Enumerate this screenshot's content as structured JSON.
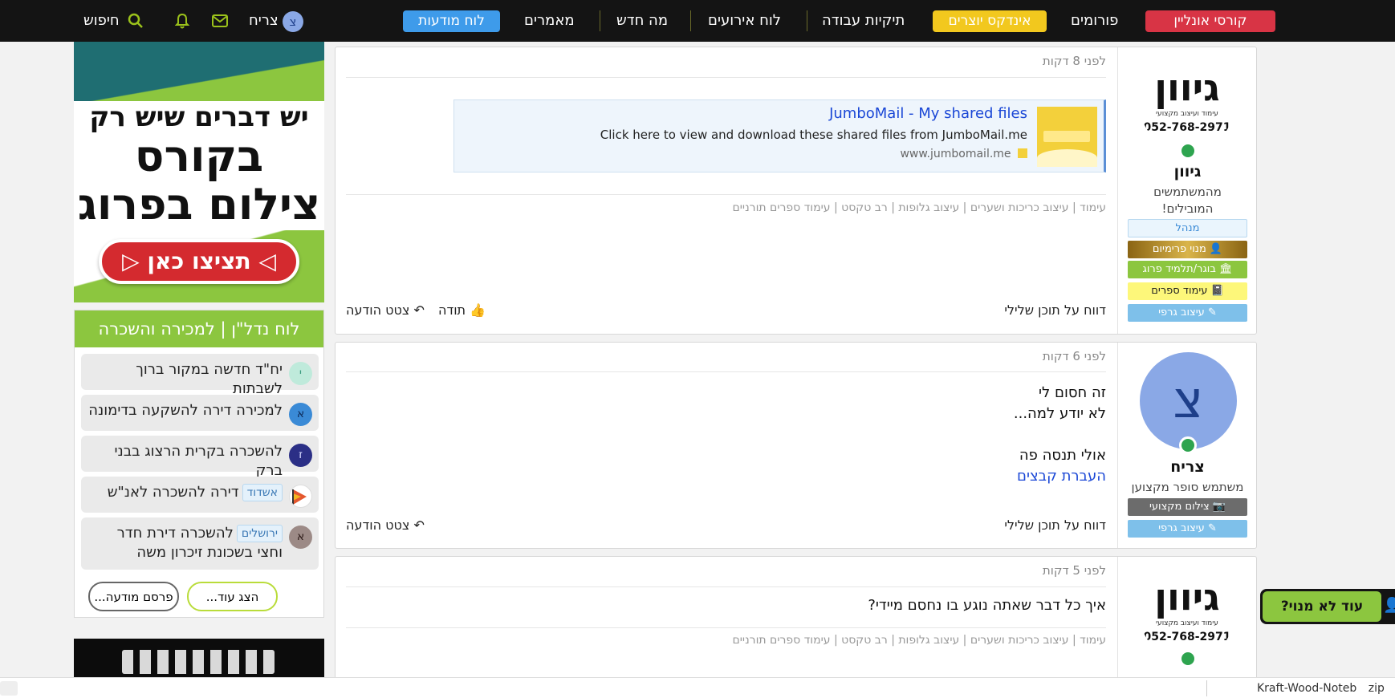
{
  "nav": {
    "online_courses": "קורסי אונליין",
    "forums": "פורומים",
    "creators_index": "אינדקס יוצרים",
    "job_portfolios": "תיקיות עבודה",
    "events_board": "לוח אירועים",
    "whats_new": "מה חדש",
    "articles": "מאמרים",
    "ads_board": "לוח מודעות",
    "user_name": "צריח",
    "user_avatar_letter": "צ",
    "search": "חיפוש"
  },
  "sidebar": {
    "ad_headline_1": "יש דברים שיש רק",
    "ad_headline_2": "בקורס",
    "ad_headline_3": "צילום בפרוג",
    "ad_cta": "תציצו כאן",
    "board_title": "לוח נדל\"ן | למכירה והשכרה",
    "items": [
      {
        "avatar": "י",
        "tag": "",
        "text": "יח\"ד חדשה במקור ברוך לשבתות"
      },
      {
        "avatar": "א",
        "tag": "",
        "text": "למכירה דירה להשקעה בדימונה"
      },
      {
        "avatar": "ז",
        "tag": "",
        "text": "להשכרה בקרית הרצוג בבני ברק"
      },
      {
        "avatar": "",
        "tag": "אשדוד",
        "text": "דירה להשכרה לאנ\"ש"
      },
      {
        "avatar": "א",
        "tag": "ירושלים",
        "text": "להשכרה דירת חדר וחצי בשכונת זיכרון משה"
      }
    ],
    "show_more": "הצג עוד...",
    "post_ad": "פרסם מודעה..."
  },
  "logo": {
    "name_art": "גיוון",
    "tagline": "עימוד ועיצוב מקצועי",
    "phone": "052-768-2971"
  },
  "posts": [
    {
      "timestamp": "לפני 8 דקות",
      "link_preview": {
        "title": "JumboMail - My shared files",
        "description": "Click here to view and download these shared files from JumboMail.me",
        "domain": "www.jumbomail.me"
      },
      "signature": "עימוד | עיצוב כריכות ושערים | עיצוב גלופות | רב טקסט | עימוד ספרים תורניים",
      "report": "דווח על תוכן שלילי",
      "thanks": "תודה",
      "quote": "צטט הודעה",
      "author": {
        "name": "גיוון",
        "title": "מהמשתמשים המובילים!",
        "role": "מנהל",
        "badges": [
          "מנוי פרימיום",
          "בוגר/תלמיד פרוג",
          "עימוד ספרים",
          "עיצוב גרפי"
        ]
      }
    },
    {
      "timestamp": "לפני 6 דקות",
      "lines": [
        "זה חסום לי",
        "לא יודע למה...",
        "אולי תנסה פה"
      ],
      "link": "העברת קבצים",
      "report": "דווח על תוכן שלילי",
      "quote": "צטט הודעה",
      "author": {
        "name": "צריח",
        "avatar_letter": "צ",
        "title": "משתמש סופר מקצוען",
        "badges": [
          "צילום מקצועי",
          "עיצוב גרפי"
        ]
      }
    },
    {
      "timestamp": "לפני 5 דקות",
      "text": "איך כל דבר שאתה נוגע בו נחסם מיידי?",
      "signature": "עימוד | עיצוב כריכות ושערים | עיצוב גלופות | רב טקסט | עימוד ספרים תורניים"
    }
  ],
  "float_tab": "עוד לא מנוי?",
  "bottom": {
    "download_item": "Kraft-Wood-Noteb",
    "download_ext": "zip"
  },
  "colors": {
    "brand_green": "#8cc63f",
    "nav_bg": "#141414",
    "link_blue": "#1a47d6",
    "red_pill": "#d83445",
    "yellow_pill": "#f2c81e",
    "blue_pill": "#3e9bea"
  }
}
